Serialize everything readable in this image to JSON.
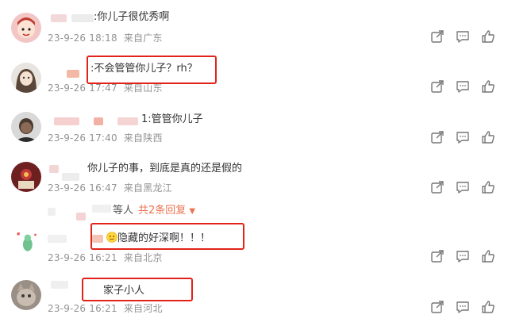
{
  "comments": [
    {
      "text": ":你儿子很优秀啊",
      "time": "23-9-26 18:18",
      "location": "来自广东"
    },
    {
      "text": ":不会管管你儿子？rh？",
      "time": "23-9-26 17:47",
      "location": "来自山东"
    },
    {
      "text": "1:管管你儿子",
      "time": "23-9-26 17:40",
      "location": "来自陕西"
    },
    {
      "text": "你儿子的事，到底是真的还是假的",
      "time": "23-9-26 16:47",
      "location": "来自黑龙江"
    },
    {
      "text": "隐藏的好深啊！！！",
      "time": "23-9-26 16:21",
      "location": "来自北京"
    },
    {
      "text": "家子小人",
      "time": "23-9-26 16:21",
      "location": "来自河北"
    }
  ],
  "reply_toggle": {
    "prefix": "等人",
    "label": "共2条回复",
    "chevron": "▼"
  },
  "icons": [
    "share-icon",
    "comment-icon",
    "like-icon"
  ],
  "colors": {
    "highlight_box": "#e2231a",
    "meta_text": "#939393",
    "reply_link": "#eb7350"
  }
}
